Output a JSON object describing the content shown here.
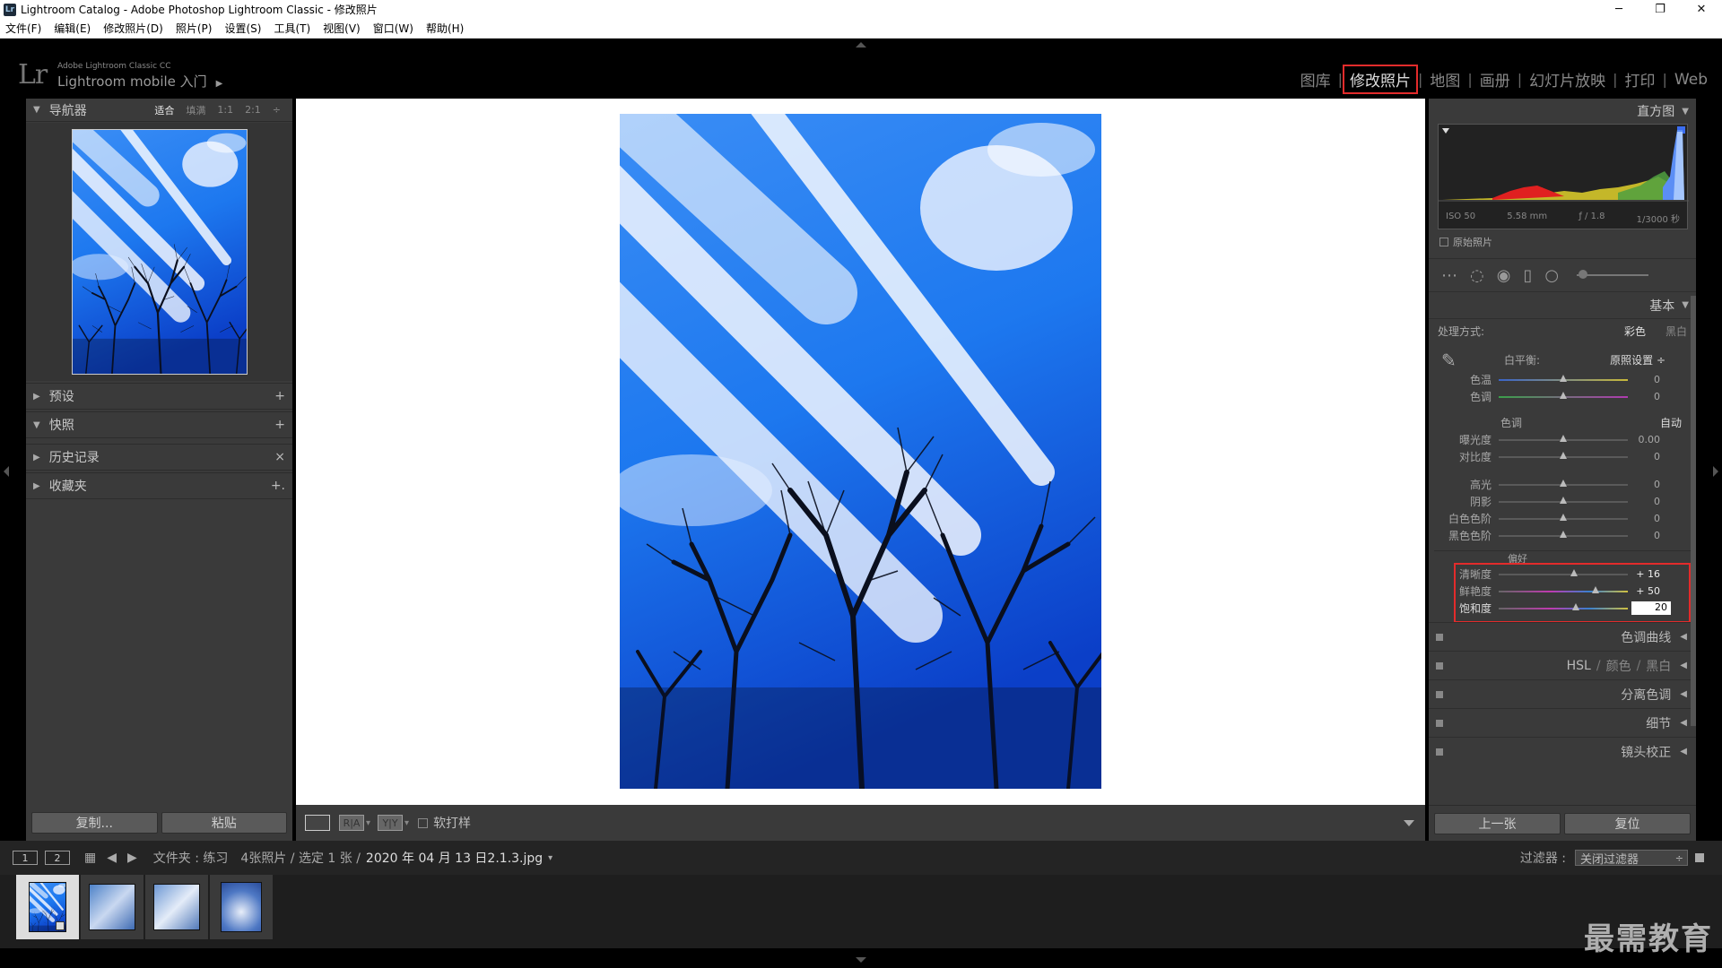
{
  "window": {
    "title": "Lightroom Catalog - Adobe Photoshop Lightroom Classic - 修改照片",
    "app_icon": "Lr",
    "minimize": "─",
    "restore": "❐",
    "close": "✕"
  },
  "menu": [
    "文件(F)",
    "编辑(E)",
    "修改照片(D)",
    "照片(P)",
    "设置(S)",
    "工具(T)",
    "视图(V)",
    "窗口(W)",
    "帮助(H)"
  ],
  "identity": {
    "logo": "Lr",
    "sub": "Adobe Lightroom Classic CC",
    "main": "Lightroom mobile 入门",
    "arrow": "▶"
  },
  "modules": {
    "library": "图库",
    "develop": "修改照片",
    "map": "地图",
    "book": "画册",
    "slideshow": "幻灯片放映",
    "print": "打印",
    "web": "Web",
    "separator": "|"
  },
  "left": {
    "navigator": {
      "title": "导航器",
      "fit": "适合",
      "fill": "填满",
      "r11": "1:1",
      "r21": "2:1",
      "more": "÷"
    },
    "presets": "预设",
    "snapshots": "快照",
    "history": "历史记录",
    "collections": "收藏夹",
    "plus": "+",
    "x": "×",
    "plus_sub": "+.",
    "copy_btn": "复制...",
    "paste_btn": "粘贴"
  },
  "toolbar": {
    "view_loupe": "",
    "view_ra": "R|A",
    "view_yy": "Y|Y",
    "dropdown": "▾",
    "soft_proof": "软打样"
  },
  "right": {
    "histogram": {
      "title": "直方图",
      "iso": "ISO 50",
      "focal": "5.58 mm",
      "aperture": "ƒ / 1.8",
      "shutter": "1/3000 秒",
      "original": "原始照片"
    },
    "basic": {
      "title": "基本",
      "treatment_label": "处理方式:",
      "color": "彩色",
      "bw": "黑白",
      "wb_label": "白平衡:",
      "wb_value": "原照设置 ÷",
      "temp": {
        "label": "色温",
        "value": "0",
        "pos": 0.5
      },
      "tint": {
        "label": "色调",
        "value": "0",
        "pos": 0.5
      },
      "tone_title": "色调",
      "auto": "自动",
      "exposure": {
        "label": "曝光度",
        "value": "0.00",
        "pos": 0.5
      },
      "contrast": {
        "label": "对比度",
        "value": "0",
        "pos": 0.5
      },
      "highlights": {
        "label": "高光",
        "value": "0",
        "pos": 0.5
      },
      "shadows": {
        "label": "阴影",
        "value": "0",
        "pos": 0.5
      },
      "whites": {
        "label": "白色色阶",
        "value": "0",
        "pos": 0.5
      },
      "blacks": {
        "label": "黑色色阶",
        "value": "0",
        "pos": 0.5
      },
      "presence_title": "偏好",
      "clarity": {
        "label": "清晰度",
        "value": "+ 16",
        "pos": 0.58
      },
      "vibrance": {
        "label": "鲜艳度",
        "value": "+ 50",
        "pos": 0.75
      },
      "saturation": {
        "label": "饱和度",
        "value": "20",
        "pos": 0.6
      }
    },
    "sections": {
      "tone_curve": "色调曲线",
      "hsl": "HSL",
      "hsl_color": "颜色",
      "hsl_bw": "黑白",
      "split": "分离色调",
      "detail": "细节",
      "lens": "镜头校正",
      "slash": "/"
    },
    "prev_btn": "上一张",
    "reset_btn": "复位"
  },
  "filmstrip": {
    "screen1": "1",
    "screen2": "2",
    "grid_icon": "▦",
    "back": "◀",
    "forward": "▶",
    "folder_label": "文件夹 : 练习",
    "count": "4张照片 / 选定 1 张 /",
    "filename": "2020 年 04 月 13 日2.1.3.jpg",
    "file_arrow": "▾",
    "filter_label": "过滤器 :",
    "filter_value": "关闭过滤器",
    "filter_arrow": "÷"
  },
  "watermark": "最需教育",
  "colors": {
    "highlight_red": "#e32b2b",
    "panel": "#3a3a3a",
    "sky_blue": "#1f6fe0"
  }
}
